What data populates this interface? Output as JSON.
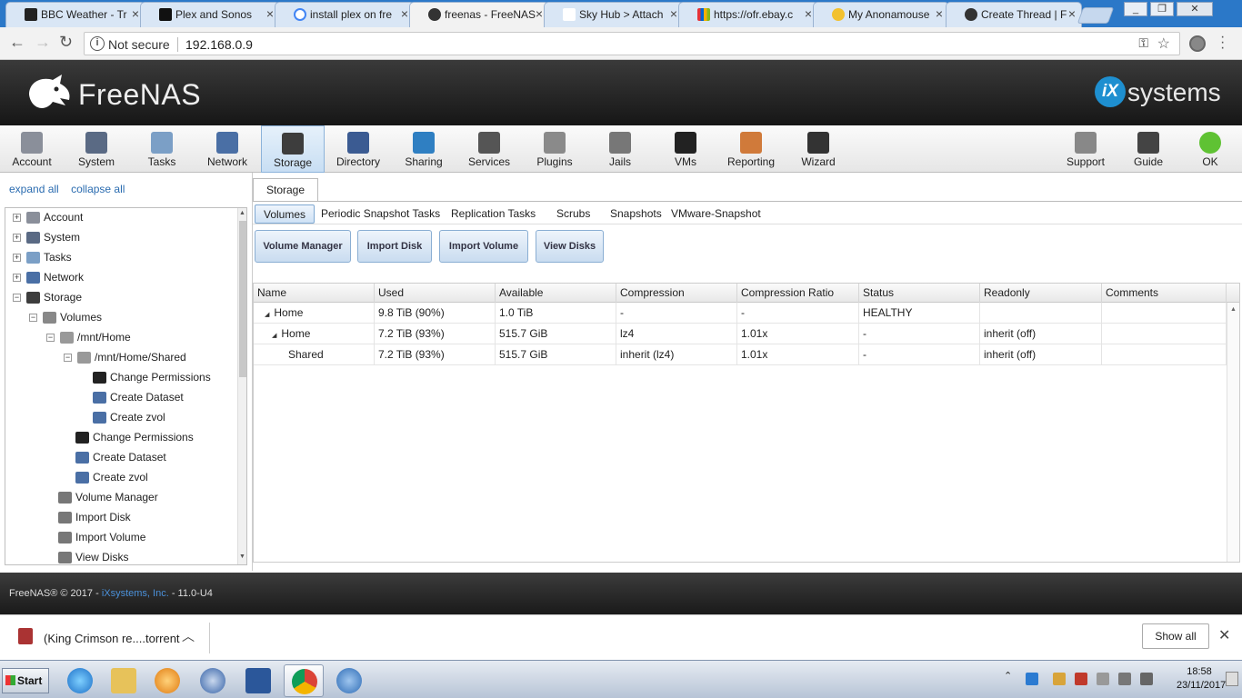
{
  "browser": {
    "tabs": [
      {
        "label": "BBC Weather - Tr"
      },
      {
        "label": "Plex and Sonos"
      },
      {
        "label": "install plex on fre"
      },
      {
        "label": "freenas - FreeNAS"
      },
      {
        "label": "Sky Hub > Attach"
      },
      {
        "label": "https://ofr.ebay.c"
      },
      {
        "label": "My Anonamouse"
      },
      {
        "label": "Create Thread | F"
      }
    ],
    "security_label": "Not secure",
    "url": "192.168.0.9"
  },
  "header": {
    "brand": "FreeNAS",
    "ix_logo_letter": "iX",
    "ix_text": "systems"
  },
  "topnav": [
    {
      "label": "Account",
      "color": "#8a8f9a"
    },
    {
      "label": "System",
      "color": "#5a6a84"
    },
    {
      "label": "Tasks",
      "color": "#7b9fc6"
    },
    {
      "label": "Network",
      "color": "#4a6fa5"
    },
    {
      "label": "Storage",
      "color": "#3d3d3d"
    },
    {
      "label": "Directory",
      "color": "#3b5b92"
    },
    {
      "label": "Sharing",
      "color": "#2f7fc2"
    },
    {
      "label": "Services",
      "color": "#555555"
    },
    {
      "label": "Plugins",
      "color": "#8a8a8a"
    },
    {
      "label": "Jails",
      "color": "#777777"
    },
    {
      "label": "VMs",
      "color": "#222222"
    },
    {
      "label": "Reporting",
      "color": "#d07a3a"
    },
    {
      "label": "Wizard",
      "color": "#333333"
    },
    {
      "label": "Support",
      "color": "#888888"
    },
    {
      "label": "Guide",
      "color": "#444444"
    },
    {
      "label": "OK",
      "color": "#5fc233"
    }
  ],
  "tree": {
    "expand_all": "expand all",
    "collapse_all": "collapse all",
    "nodes": [
      {
        "label": "Account",
        "pm": "+"
      },
      {
        "label": "System",
        "pm": "+"
      },
      {
        "label": "Tasks",
        "pm": "+"
      },
      {
        "label": "Network",
        "pm": "+"
      },
      {
        "label": "Storage",
        "pm": "−"
      },
      {
        "label": "Volumes",
        "pm": "−"
      },
      {
        "label": "/mnt/Home",
        "pm": "−"
      },
      {
        "label": "/mnt/Home/Shared",
        "pm": "−"
      },
      {
        "label": "Change Permissions",
        "pm": ""
      },
      {
        "label": "Create Dataset",
        "pm": ""
      },
      {
        "label": "Create zvol",
        "pm": ""
      },
      {
        "label": "Change Permissions",
        "pm": ""
      },
      {
        "label": "Create Dataset",
        "pm": ""
      },
      {
        "label": "Create zvol",
        "pm": ""
      },
      {
        "label": "Volume Manager",
        "pm": ""
      },
      {
        "label": "Import Disk",
        "pm": ""
      },
      {
        "label": "Import Volume",
        "pm": ""
      },
      {
        "label": "View Disks",
        "pm": ""
      }
    ]
  },
  "storage": {
    "tab_label": "Storage",
    "subtabs": [
      "Volumes",
      "Periodic Snapshot Tasks",
      "Replication Tasks",
      "Scrubs",
      "Snapshots",
      "VMware-Snapshot"
    ],
    "buttons": [
      "Volume Manager",
      "Import Disk",
      "Import Volume",
      "View Disks"
    ],
    "columns": [
      "Name",
      "Used",
      "Available",
      "Compression",
      "Compression Ratio",
      "Status",
      "Readonly",
      "Comments"
    ],
    "rows": [
      {
        "name": "Home",
        "used": "9.8 TiB (90%)",
        "available": "1.0 TiB",
        "compression": "-",
        "ratio": "-",
        "status": "HEALTHY",
        "readonly": "",
        "comments": ""
      },
      {
        "name": "Home",
        "used": "7.2 TiB (93%)",
        "available": "515.7 GiB",
        "compression": "lz4",
        "ratio": "1.01x",
        "status": "-",
        "readonly": "inherit (off)",
        "comments": ""
      },
      {
        "name": "Shared",
        "used": "7.2 TiB (93%)",
        "available": "515.7 GiB",
        "compression": "inherit (lz4)",
        "ratio": "1.01x",
        "status": "-",
        "readonly": "inherit (off)",
        "comments": ""
      }
    ]
  },
  "footer": {
    "prefix": "FreeNAS® © 2017 - ",
    "company": "iXsystems, Inc.",
    "suffix": " - 11.0-U4"
  },
  "download": {
    "filename": "(King Crimson re....torrent",
    "show_all": "Show all"
  },
  "taskbar": {
    "start": "Start",
    "time": "18:58",
    "date": "23/11/2017"
  }
}
